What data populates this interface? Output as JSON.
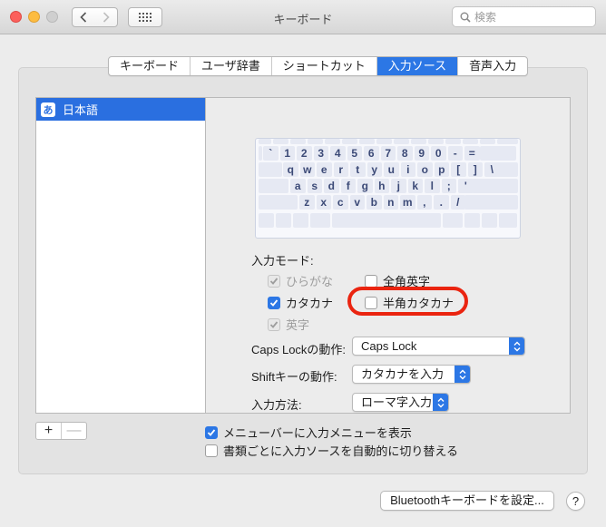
{
  "window": {
    "title": "キーボード"
  },
  "search": {
    "placeholder": "検索"
  },
  "tabs": [
    {
      "label": "キーボード",
      "active": false
    },
    {
      "label": "ユーザ辞書",
      "active": false
    },
    {
      "label": "ショートカット",
      "active": false
    },
    {
      "label": "入力ソース",
      "active": true
    },
    {
      "label": "音声入力",
      "active": false
    }
  ],
  "sources": [
    {
      "icon_text": "あ",
      "label": "日本語",
      "selected": true
    }
  ],
  "keyboard": {
    "rows": [
      [
        "`",
        "1",
        "2",
        "3",
        "4",
        "5",
        "6",
        "7",
        "8",
        "9",
        "0",
        "-",
        "="
      ],
      [
        "q",
        "w",
        "e",
        "r",
        "t",
        "y",
        "u",
        "i",
        "o",
        "p",
        "[",
        "]",
        "\\"
      ],
      [
        "a",
        "s",
        "d",
        "f",
        "g",
        "h",
        "j",
        "k",
        "l",
        ";",
        "'"
      ],
      [
        "z",
        "x",
        "c",
        "v",
        "b",
        "n",
        "m",
        ",",
        ".",
        "/"
      ]
    ]
  },
  "input_mode": {
    "label": "入力モード:",
    "hiragana": {
      "label": "ひらがな",
      "checked": true,
      "disabled": true
    },
    "zenkaku_eiji": {
      "label": "全角英字",
      "checked": false
    },
    "katakana": {
      "label": "カタカナ",
      "checked": true
    },
    "hankaku_katakana": {
      "label": "半角カタカナ",
      "checked": false
    },
    "eiji": {
      "label": "英字",
      "checked": true,
      "disabled": true
    }
  },
  "caps_lock": {
    "label": "Caps Lockの動作:",
    "value": "Caps Lock"
  },
  "shift": {
    "label": "Shiftキーの動作:",
    "value": "カタカナを入力"
  },
  "input_method": {
    "label": "入力方法:",
    "value": "ローマ字入力"
  },
  "list_buttons": {
    "plus": "+",
    "minus": "—"
  },
  "options": {
    "show_menu": {
      "label": "メニューバーに入力メニューを表示",
      "checked": true
    },
    "auto_switch": {
      "label": "書類ごとに入力ソースを自動的に切り替える",
      "checked": false
    }
  },
  "bluetooth_button": {
    "label": "Bluetoothキーボードを設定..."
  },
  "help_button": {
    "label": "?"
  },
  "colors": {
    "accent": "#2c77e5",
    "highlight_ring": "#ea2410"
  }
}
